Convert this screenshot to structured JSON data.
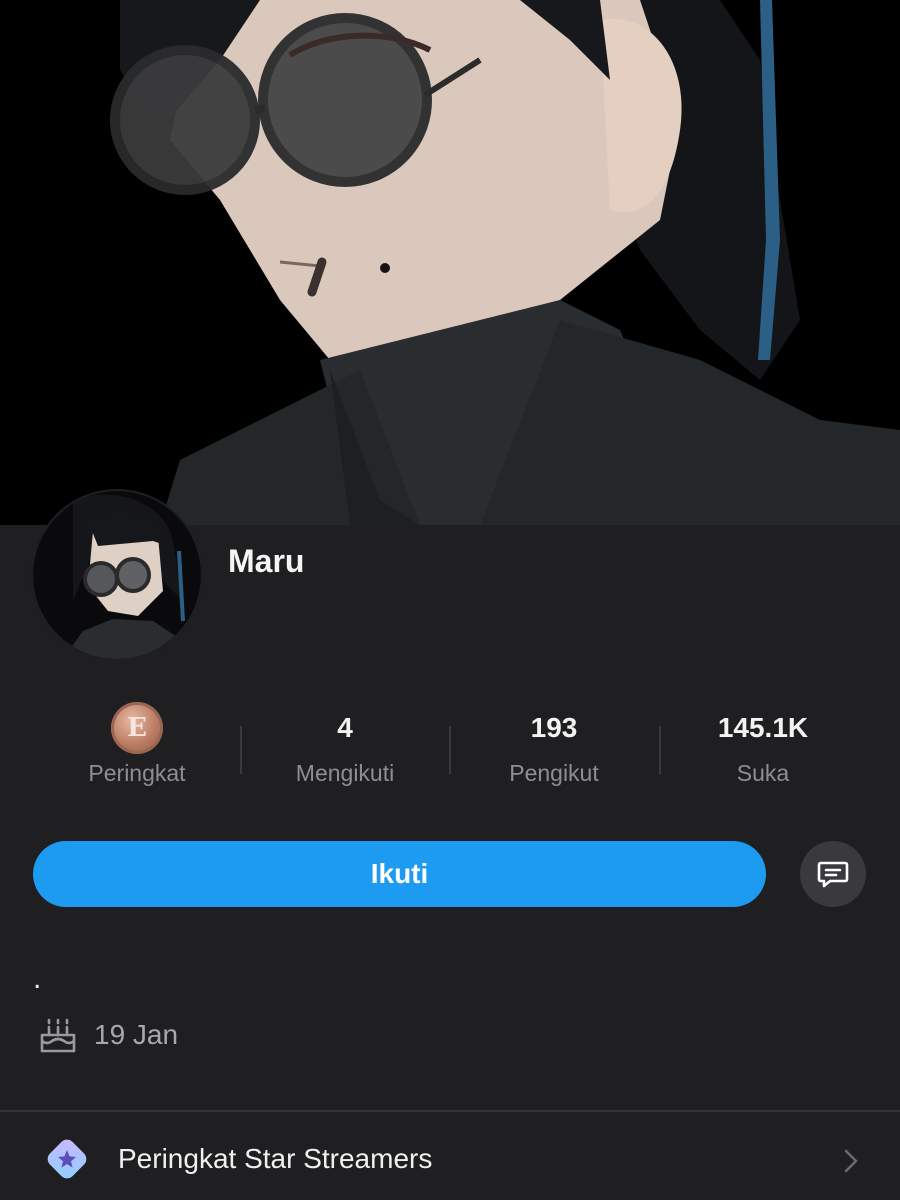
{
  "profile": {
    "display_name": "Maru",
    "avatar_icon": "avatar-illustration",
    "cover_icon": "cover-illustration"
  },
  "stats": [
    {
      "label": "Peringkat",
      "badge": "E"
    },
    {
      "label": "Mengikuti",
      "value": "4"
    },
    {
      "label": "Pengikut",
      "value": "193"
    },
    {
      "label": "Suka",
      "value": "145.1K"
    }
  ],
  "actions": {
    "follow_label": "Ikuti",
    "message_icon": "message-icon"
  },
  "bio": {
    "text": ".",
    "birthday": "19 Jan",
    "birthday_icon": "cake-icon"
  },
  "menu": {
    "items": [
      {
        "label": "Peringkat Star Streamers",
        "icon": "star-streamers-icon"
      }
    ]
  },
  "colors": {
    "accent": "#1d9bf0",
    "background": "#1f1f21",
    "muted_text": "#8f8f92",
    "rank_bronze": "#b97a61"
  }
}
